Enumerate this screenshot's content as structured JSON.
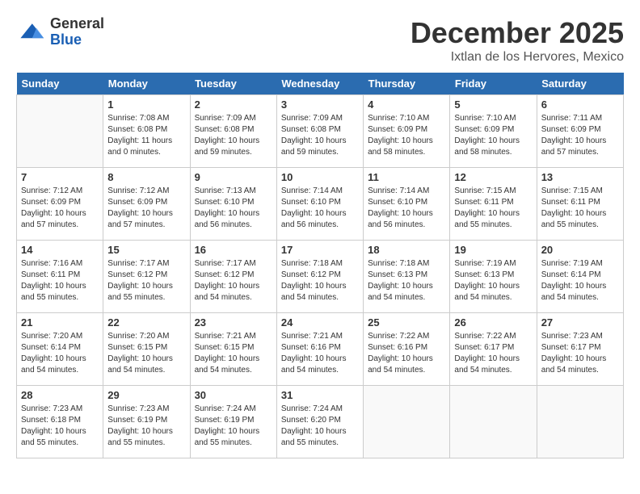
{
  "logo": {
    "general": "General",
    "blue": "Blue"
  },
  "header": {
    "month_year": "December 2025",
    "location": "Ixtlan de los Hervores, Mexico"
  },
  "weekdays": [
    "Sunday",
    "Monday",
    "Tuesday",
    "Wednesday",
    "Thursday",
    "Friday",
    "Saturday"
  ],
  "weeks": [
    [
      {
        "day": "",
        "info": ""
      },
      {
        "day": "1",
        "info": "Sunrise: 7:08 AM\nSunset: 6:08 PM\nDaylight: 11 hours\nand 0 minutes."
      },
      {
        "day": "2",
        "info": "Sunrise: 7:09 AM\nSunset: 6:08 PM\nDaylight: 10 hours\nand 59 minutes."
      },
      {
        "day": "3",
        "info": "Sunrise: 7:09 AM\nSunset: 6:08 PM\nDaylight: 10 hours\nand 59 minutes."
      },
      {
        "day": "4",
        "info": "Sunrise: 7:10 AM\nSunset: 6:09 PM\nDaylight: 10 hours\nand 58 minutes."
      },
      {
        "day": "5",
        "info": "Sunrise: 7:10 AM\nSunset: 6:09 PM\nDaylight: 10 hours\nand 58 minutes."
      },
      {
        "day": "6",
        "info": "Sunrise: 7:11 AM\nSunset: 6:09 PM\nDaylight: 10 hours\nand 57 minutes."
      }
    ],
    [
      {
        "day": "7",
        "info": "Sunrise: 7:12 AM\nSunset: 6:09 PM\nDaylight: 10 hours\nand 57 minutes."
      },
      {
        "day": "8",
        "info": "Sunrise: 7:12 AM\nSunset: 6:09 PM\nDaylight: 10 hours\nand 57 minutes."
      },
      {
        "day": "9",
        "info": "Sunrise: 7:13 AM\nSunset: 6:10 PM\nDaylight: 10 hours\nand 56 minutes."
      },
      {
        "day": "10",
        "info": "Sunrise: 7:14 AM\nSunset: 6:10 PM\nDaylight: 10 hours\nand 56 minutes."
      },
      {
        "day": "11",
        "info": "Sunrise: 7:14 AM\nSunset: 6:10 PM\nDaylight: 10 hours\nand 56 minutes."
      },
      {
        "day": "12",
        "info": "Sunrise: 7:15 AM\nSunset: 6:11 PM\nDaylight: 10 hours\nand 55 minutes."
      },
      {
        "day": "13",
        "info": "Sunrise: 7:15 AM\nSunset: 6:11 PM\nDaylight: 10 hours\nand 55 minutes."
      }
    ],
    [
      {
        "day": "14",
        "info": "Sunrise: 7:16 AM\nSunset: 6:11 PM\nDaylight: 10 hours\nand 55 minutes."
      },
      {
        "day": "15",
        "info": "Sunrise: 7:17 AM\nSunset: 6:12 PM\nDaylight: 10 hours\nand 55 minutes."
      },
      {
        "day": "16",
        "info": "Sunrise: 7:17 AM\nSunset: 6:12 PM\nDaylight: 10 hours\nand 54 minutes."
      },
      {
        "day": "17",
        "info": "Sunrise: 7:18 AM\nSunset: 6:12 PM\nDaylight: 10 hours\nand 54 minutes."
      },
      {
        "day": "18",
        "info": "Sunrise: 7:18 AM\nSunset: 6:13 PM\nDaylight: 10 hours\nand 54 minutes."
      },
      {
        "day": "19",
        "info": "Sunrise: 7:19 AM\nSunset: 6:13 PM\nDaylight: 10 hours\nand 54 minutes."
      },
      {
        "day": "20",
        "info": "Sunrise: 7:19 AM\nSunset: 6:14 PM\nDaylight: 10 hours\nand 54 minutes."
      }
    ],
    [
      {
        "day": "21",
        "info": "Sunrise: 7:20 AM\nSunset: 6:14 PM\nDaylight: 10 hours\nand 54 minutes."
      },
      {
        "day": "22",
        "info": "Sunrise: 7:20 AM\nSunset: 6:15 PM\nDaylight: 10 hours\nand 54 minutes."
      },
      {
        "day": "23",
        "info": "Sunrise: 7:21 AM\nSunset: 6:15 PM\nDaylight: 10 hours\nand 54 minutes."
      },
      {
        "day": "24",
        "info": "Sunrise: 7:21 AM\nSunset: 6:16 PM\nDaylight: 10 hours\nand 54 minutes."
      },
      {
        "day": "25",
        "info": "Sunrise: 7:22 AM\nSunset: 6:16 PM\nDaylight: 10 hours\nand 54 minutes."
      },
      {
        "day": "26",
        "info": "Sunrise: 7:22 AM\nSunset: 6:17 PM\nDaylight: 10 hours\nand 54 minutes."
      },
      {
        "day": "27",
        "info": "Sunrise: 7:23 AM\nSunset: 6:17 PM\nDaylight: 10 hours\nand 54 minutes."
      }
    ],
    [
      {
        "day": "28",
        "info": "Sunrise: 7:23 AM\nSunset: 6:18 PM\nDaylight: 10 hours\nand 55 minutes."
      },
      {
        "day": "29",
        "info": "Sunrise: 7:23 AM\nSunset: 6:19 PM\nDaylight: 10 hours\nand 55 minutes."
      },
      {
        "day": "30",
        "info": "Sunrise: 7:24 AM\nSunset: 6:19 PM\nDaylight: 10 hours\nand 55 minutes."
      },
      {
        "day": "31",
        "info": "Sunrise: 7:24 AM\nSunset: 6:20 PM\nDaylight: 10 hours\nand 55 minutes."
      },
      {
        "day": "",
        "info": ""
      },
      {
        "day": "",
        "info": ""
      },
      {
        "day": "",
        "info": ""
      }
    ]
  ]
}
